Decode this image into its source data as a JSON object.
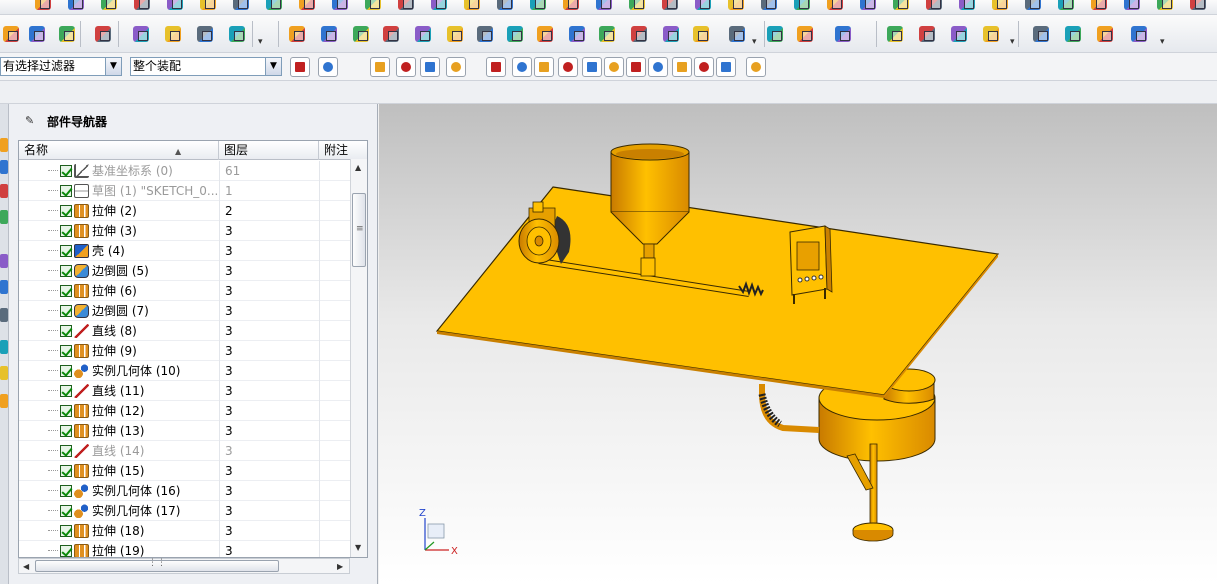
{
  "filters": {
    "selection_filter": "有选择过滤器",
    "assembly_scope": "整个装配"
  },
  "navigator": {
    "title": "部件导航器",
    "columns": {
      "name": "名称",
      "layer": "图层",
      "note": "附注"
    },
    "rows": [
      {
        "label": "基准坐标系 (0)",
        "layer": "61",
        "icon": "datum-csys-icon",
        "dim": true
      },
      {
        "label": "草图 (1) \"SKETCH_0...",
        "layer": "1",
        "icon": "sketch-icon",
        "dim": true
      },
      {
        "label": "拉伸 (2)",
        "layer": "2",
        "icon": "extrude-icon",
        "dim": false
      },
      {
        "label": "拉伸 (3)",
        "layer": "3",
        "icon": "extrude-icon",
        "dim": false
      },
      {
        "label": "壳 (4)",
        "layer": "3",
        "icon": "shell-icon",
        "dim": false
      },
      {
        "label": "边倒圆 (5)",
        "layer": "3",
        "icon": "edge-blend-icon",
        "dim": false
      },
      {
        "label": "拉伸 (6)",
        "layer": "3",
        "icon": "extrude-icon",
        "dim": false
      },
      {
        "label": "边倒圆 (7)",
        "layer": "3",
        "icon": "edge-blend-icon",
        "dim": false
      },
      {
        "label": "直线 (8)",
        "layer": "3",
        "icon": "line-icon",
        "dim": false
      },
      {
        "label": "拉伸 (9)",
        "layer": "3",
        "icon": "extrude-icon",
        "dim": false
      },
      {
        "label": "实例几何体 (10)",
        "layer": "3",
        "icon": "instance-geometry-icon",
        "dim": false
      },
      {
        "label": "直线 (11)",
        "layer": "3",
        "icon": "line-icon",
        "dim": false
      },
      {
        "label": "拉伸 (12)",
        "layer": "3",
        "icon": "extrude-icon",
        "dim": false
      },
      {
        "label": "拉伸 (13)",
        "layer": "3",
        "icon": "extrude-icon",
        "dim": false
      },
      {
        "label": "直线 (14)",
        "layer": "3",
        "icon": "line-icon",
        "dim": true
      },
      {
        "label": "拉伸 (15)",
        "layer": "3",
        "icon": "extrude-icon",
        "dim": false
      },
      {
        "label": "实例几何体 (16)",
        "layer": "3",
        "icon": "instance-geometry-icon",
        "dim": false
      },
      {
        "label": "实例几何体 (17)",
        "layer": "3",
        "icon": "instance-geometry-icon",
        "dim": false
      },
      {
        "label": "拉伸 (18)",
        "layer": "3",
        "icon": "extrude-icon",
        "dim": false
      },
      {
        "label": "拉伸 (19)",
        "layer": "3",
        "icon": "extrude-icon",
        "dim": false
      }
    ]
  },
  "triad": {
    "x": "X",
    "z": "Z"
  },
  "colors": {
    "model_body": "#ffc000",
    "model_shade": "#d98a00",
    "edge": "#3a2a00",
    "brush": "#222222"
  }
}
